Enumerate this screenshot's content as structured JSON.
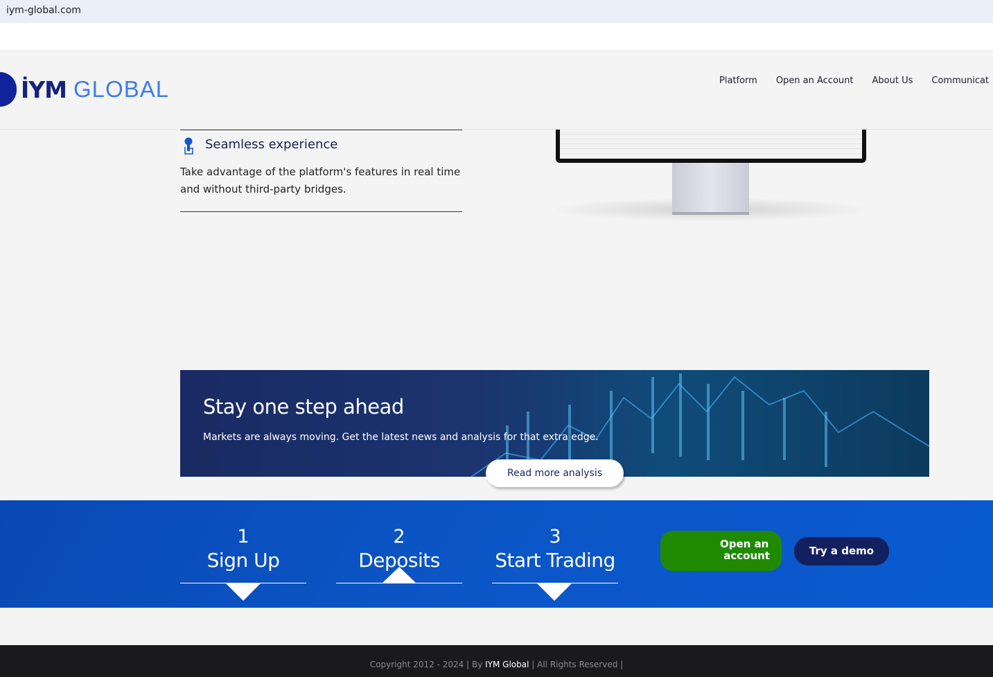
{
  "browser": {
    "url": "iym-global.com"
  },
  "header": {
    "logo_iym": "İYM",
    "logo_global": "GLOBAL",
    "nav": [
      "Platform",
      "Open an Account",
      "About Us",
      "Communicat"
    ]
  },
  "feature": {
    "title": "Seamless experience",
    "text_line1": "Take advantage of the platform's features in real time",
    "text_line2": "and without third-party bridges."
  },
  "banner": {
    "title": "Stay one step ahead",
    "subtitle": "Markets are always moving. Get the latest news and analysis for that extra edge.",
    "button": "Read more analysis"
  },
  "steps": [
    {
      "number": "1",
      "label": "Sign Up"
    },
    {
      "number": "2",
      "label": "Deposits"
    },
    {
      "number": "3",
      "label": "Start Trading"
    }
  ],
  "cta": {
    "open_line1": "Open an",
    "open_line2": "account",
    "demo": "Try a demo"
  },
  "footer": {
    "prefix": "Copyright 2012 - 2024 | By ",
    "brand": "IYM Global",
    "suffix": " | All Rights Reserved |"
  },
  "colors": {
    "brand_navy": "#14237f",
    "brand_blue": "#3f7de6",
    "green": "#1f8a00",
    "section_blue": "#0b56c7"
  }
}
